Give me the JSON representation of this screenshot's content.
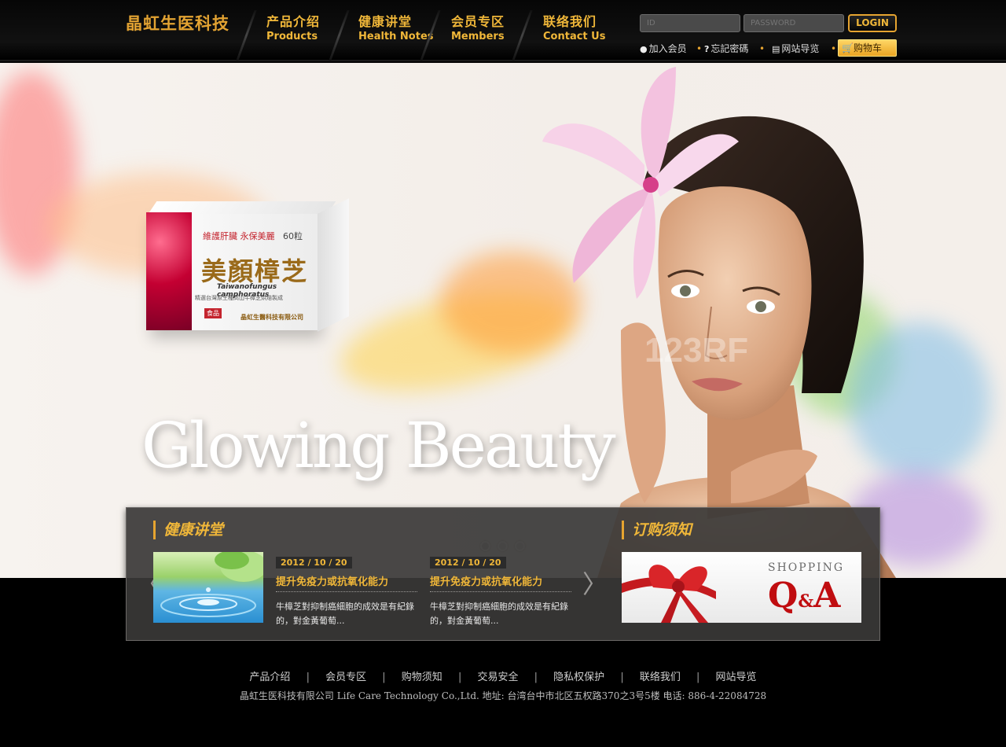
{
  "header": {
    "logo": "晶虹生医科技",
    "nav": [
      {
        "cn": "产品介绍",
        "en": "Products"
      },
      {
        "cn": "健康讲堂",
        "en": "Health Notes"
      },
      {
        "cn": "会员专区",
        "en": "Members"
      },
      {
        "cn": "联络我们",
        "en": "Contact Us"
      }
    ],
    "login": {
      "id_placeholder": "ID",
      "password_placeholder": "PASSWORD",
      "button": "LOGIN"
    },
    "links": {
      "join": "加入会员",
      "forgot": "忘記密碼",
      "sitemap": "网站导览",
      "cart": "购物车"
    }
  },
  "hero": {
    "product": {
      "tagline": "維護肝臟  永保美麗",
      "count": "60粒",
      "name": "美顏樟芝",
      "latin": "Taiwanofungus camphoratus",
      "desc": "精選台灣原生種高山牛樟芝烘焙製成",
      "category": "食品",
      "company": "晶虹生醫科技有限公司"
    },
    "slogan": "Glowing Beauty",
    "watermark": "123RF",
    "slides": 3,
    "active_slide": 1
  },
  "panel": {
    "health": {
      "title": "健康讲堂",
      "items": [
        {
          "date": "2012 / 10 / 20",
          "title": "提升免疫力或抗氧化能力",
          "body": "牛樟芝對抑制癌細胞的成效是有紀錄的，對金黃葡萄..."
        },
        {
          "date": "2012 / 10 / 20",
          "title": "提升免疫力或抗氧化能力",
          "body": "牛樟芝對抑制癌細胞的成效是有紀錄的，對金黃葡萄..."
        }
      ]
    },
    "order": {
      "title": "订购须知",
      "banner_small": "SHOPPING",
      "banner_q": "Q",
      "banner_amp": "&",
      "banner_a": "A"
    }
  },
  "footer": {
    "links": [
      "产品介绍",
      "会员专区",
      "购物须知",
      "交易安全",
      "隐私权保护",
      "联络我们",
      "网站导览"
    ],
    "separator": "|",
    "info": "晶虹生医科技有限公司   Life Care Technology Co.,Ltd. 地址: 台湾台中市北区五权路370之3号5楼    电话: 886-4-22084728"
  },
  "colors": {
    "accent": "#f0b739",
    "header_bg": "#0b0b0b",
    "panel_bg": "#3a3837",
    "hero_bg": "#f5f0eb",
    "qa_red": "#c00d10"
  }
}
